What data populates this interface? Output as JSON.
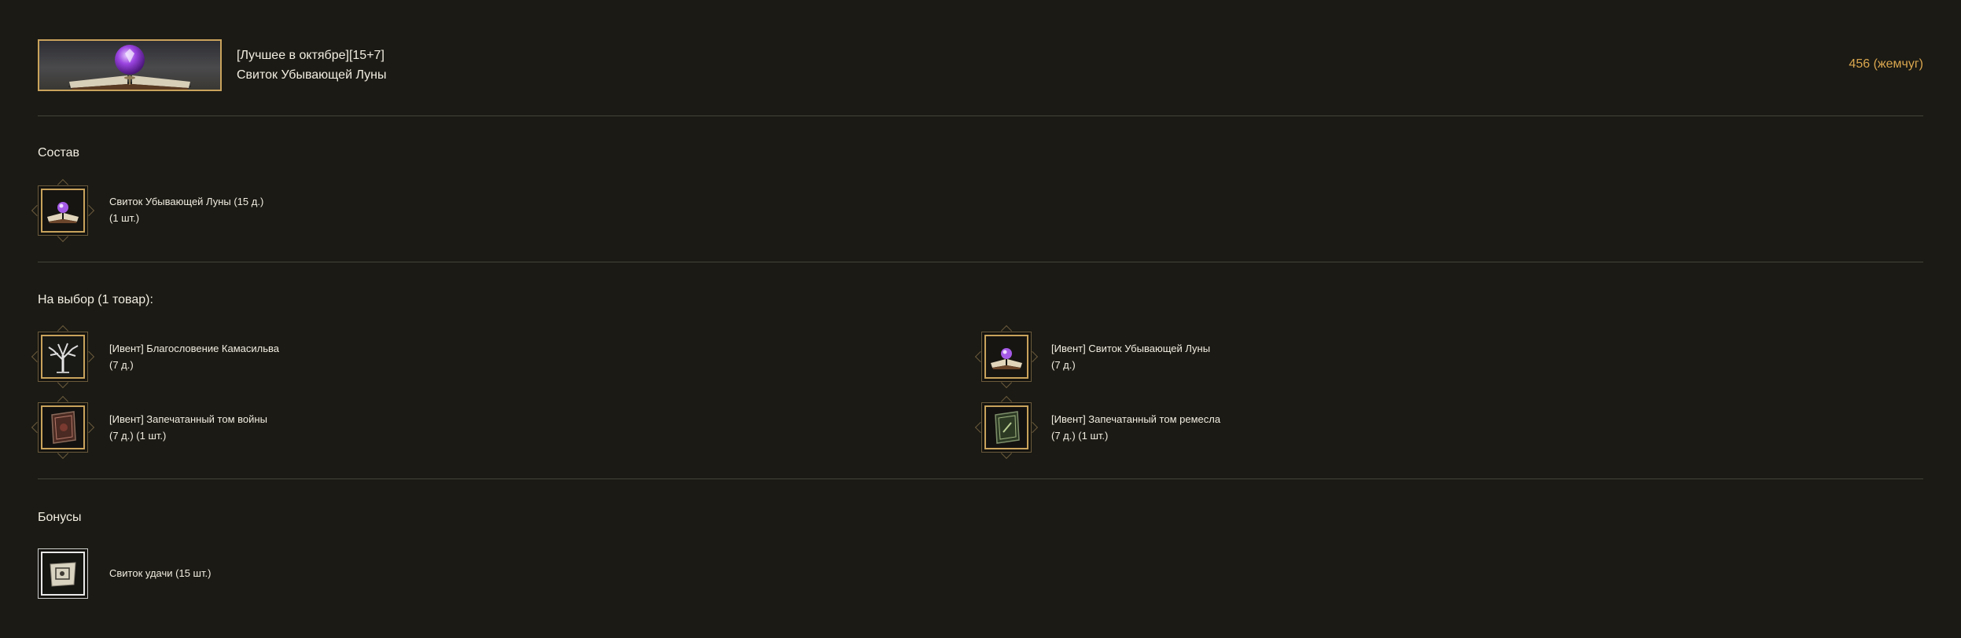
{
  "header": {
    "title_line1": "[Лучшее в октябре][15+7]",
    "title_line2": "Свиток Убывающей Луны",
    "price": "456 (жемчуг)",
    "image_icon": "moon-scroll-book-icon"
  },
  "composition": {
    "title": "Состав",
    "items": [
      {
        "name": "Свиток Убывающей Луны (15 д.)",
        "detail": "(1 шт.)",
        "icon": "moon-scroll-icon"
      }
    ]
  },
  "choice": {
    "title": "На выбор (1 товар):",
    "items": [
      {
        "name": "[Ивент] Благословение Камасильва",
        "detail": "(7 д.)",
        "icon": "silver-tree-icon"
      },
      {
        "name": "[Ивент] Свиток Убывающей Луны",
        "detail": "(7 д.)",
        "icon": "moon-scroll-icon"
      },
      {
        "name": "[Ивент] Запечатанный том войны",
        "detail": "(7 д.) (1 шт.)",
        "icon": "sealed-war-tome-icon"
      },
      {
        "name": "[Ивент] Запечатанный том ремесла",
        "detail": "(7 д.) (1 шт.)",
        "icon": "sealed-craft-tome-icon"
      }
    ]
  },
  "bonuses": {
    "title": "Бонусы",
    "items": [
      {
        "name": "Свиток удачи (15 шт.)",
        "icon": "luck-scroll-icon"
      }
    ]
  },
  "colors": {
    "background": "#1b1a14",
    "accent_gold": "#c9a35c",
    "price_color": "#d9a64f",
    "divider": "#45443a"
  }
}
